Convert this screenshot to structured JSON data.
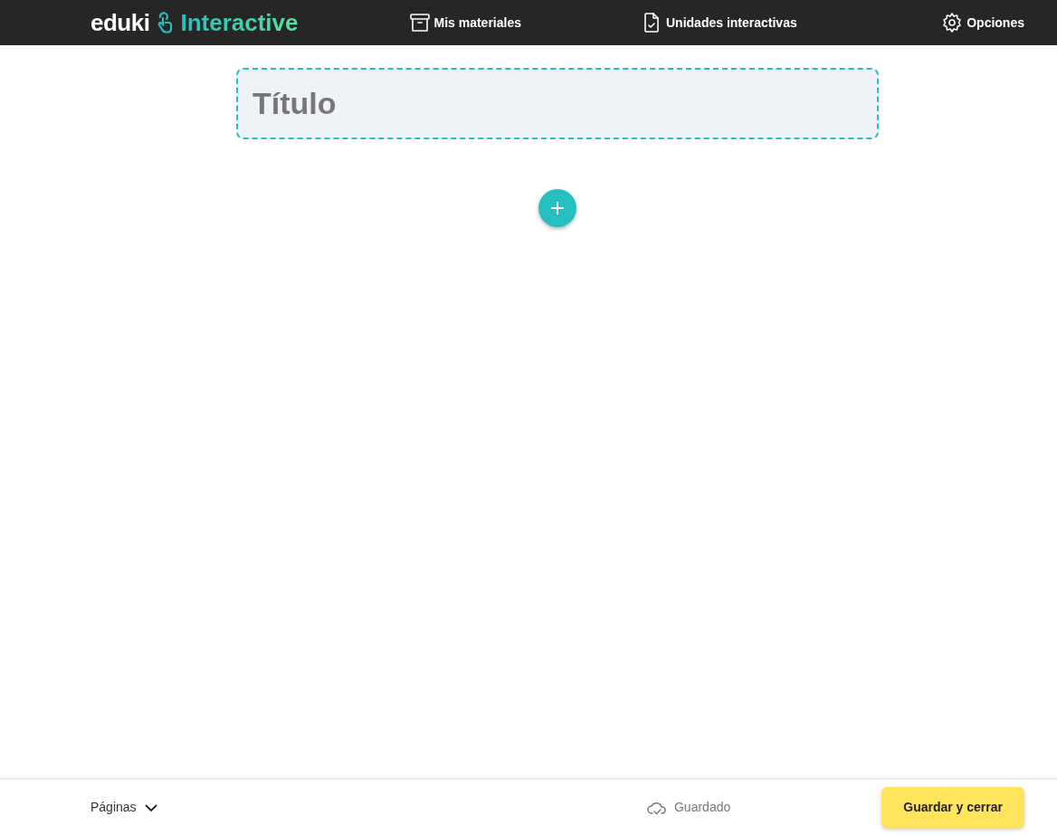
{
  "header": {
    "logo": {
      "brand": "eduki",
      "product": "Interactive"
    },
    "nav": [
      {
        "kind": "archive",
        "label": "Mis materiales"
      },
      {
        "kind": "document",
        "label": "Unidades interactivas"
      },
      {
        "kind": "settings",
        "label": "Opciones"
      }
    ]
  },
  "editor": {
    "title_field": {
      "placeholder": "Título"
    },
    "add_button": "+"
  },
  "footer": {
    "pages_menu": "Páginas",
    "save_status": "Guardado",
    "save_button": "Guardar y cerrar"
  }
}
